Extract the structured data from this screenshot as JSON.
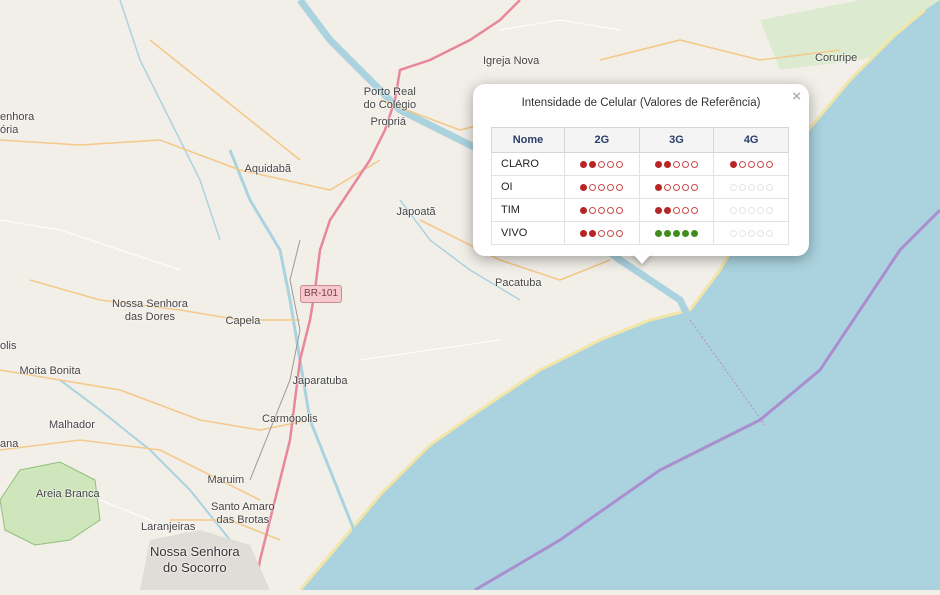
{
  "map": {
    "places": [
      {
        "name": "Igreja Nova",
        "cls": ""
      },
      {
        "name": "Coruripe",
        "cls": ""
      },
      {
        "name": "Porto Real\ndo Colégio",
        "cls": ""
      },
      {
        "name": "Propriá",
        "cls": ""
      },
      {
        "name": "Aquidabã",
        "cls": ""
      },
      {
        "name": "Japoatã",
        "cls": ""
      },
      {
        "name": "Pacatuba",
        "cls": ""
      },
      {
        "name": "Nossa Senhora\ndas Dores",
        "cls": ""
      },
      {
        "name": "Capela",
        "cls": ""
      },
      {
        "name": "Japaratuba",
        "cls": ""
      },
      {
        "name": "Moita Bonita",
        "cls": ""
      },
      {
        "name": "Carmópolis",
        "cls": ""
      },
      {
        "name": "Malhador",
        "cls": ""
      },
      {
        "name": "Maruim",
        "cls": ""
      },
      {
        "name": "Areia Branca",
        "cls": ""
      },
      {
        "name": "Santo Amaro\ndas Brotas",
        "cls": ""
      },
      {
        "name": "Laranjeiras",
        "cls": ""
      },
      {
        "name": "Nossa Senhora\ndo Socorro",
        "cls": "big"
      },
      {
        "name": "enhora",
        "cls": ""
      },
      {
        "name": "ória",
        "cls": ""
      },
      {
        "name": "olis",
        "cls": ""
      },
      {
        "name": "ana",
        "cls": ""
      }
    ],
    "road_shield": "BR-101",
    "colors": {
      "sea": "#aad3df",
      "land": "#f2efe9",
      "river": "#aad3df",
      "main_road": "#e8879a",
      "boundary": "#a98fd0"
    }
  },
  "popup": {
    "title": "Intensidade de Celular (Valores de Referência)",
    "close_label": "×",
    "headers": [
      "Nome",
      "2G",
      "3G",
      "4G"
    ],
    "max_level": 5,
    "rows": [
      {
        "name": "CLARO",
        "g2": 2,
        "g3": 2,
        "g4": 1,
        "g3_color": "red",
        "g4_state": "available"
      },
      {
        "name": "OI",
        "g2": 1,
        "g3": 1,
        "g4": 0,
        "g3_color": "red",
        "g4_state": "unavailable"
      },
      {
        "name": "TIM",
        "g2": 1,
        "g3": 2,
        "g4": 0,
        "g3_color": "red",
        "g4_state": "unavailable"
      },
      {
        "name": "VIVO",
        "g2": 2,
        "g3": 5,
        "g4": 0,
        "g3_color": "green",
        "g4_state": "unavailable"
      }
    ]
  }
}
